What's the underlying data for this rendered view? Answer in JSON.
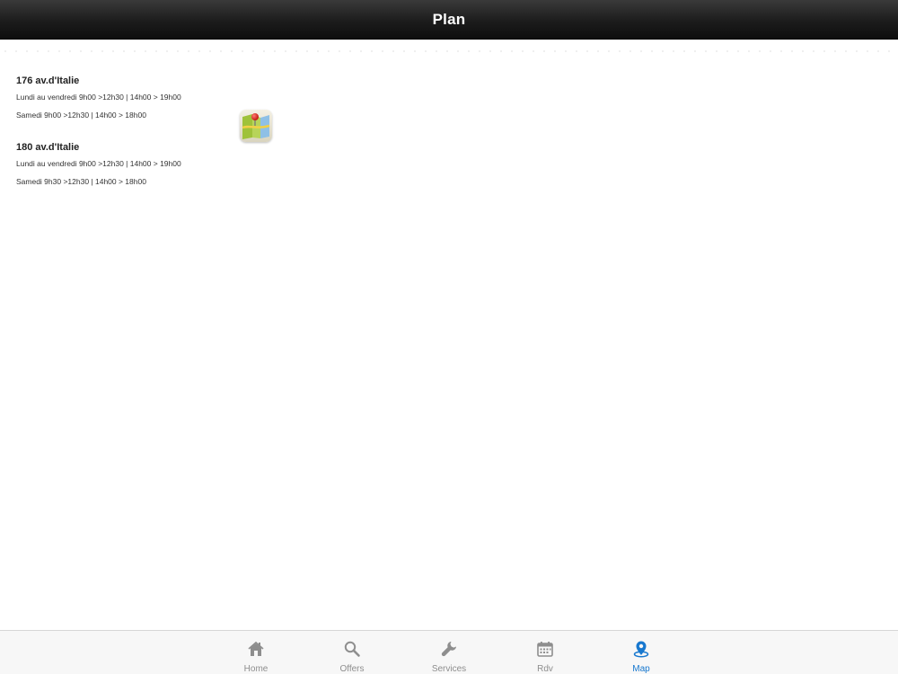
{
  "navbar": {
    "title": "Plan"
  },
  "locations": [
    {
      "address": "176 av.d'Italie",
      "hours_weekdays": "Lundi au vendredi 9h00 >12h30 | 14h00 > 19h00",
      "hours_saturday": "Samedi 9h00 >12h30 | 14h00 > 18h00"
    },
    {
      "address": "180 av.d'Italie",
      "hours_weekdays": "Lundi au vendredi 9h00 >12h30 | 14h00 > 19h00",
      "hours_saturday": "Samedi 9h30 >12h30 | 14h00 > 18h00"
    }
  ],
  "map_button": {
    "icon": "maps-app-icon"
  },
  "tabbar": {
    "tabs": [
      {
        "label": "Home",
        "icon": "home-icon",
        "active": false
      },
      {
        "label": "Offers",
        "icon": "search-icon",
        "active": false
      },
      {
        "label": "Services",
        "icon": "wrench-icon",
        "active": false
      },
      {
        "label": "Rdv",
        "icon": "calendar-icon",
        "active": false
      },
      {
        "label": "Map",
        "icon": "map-pin-icon",
        "active": true
      }
    ]
  },
  "colors": {
    "navbar_bg": "#1c1c1c",
    "active_tab": "#1878cf",
    "inactive_tab": "#8e8e8e",
    "tabbar_bg": "#f7f7f7"
  }
}
